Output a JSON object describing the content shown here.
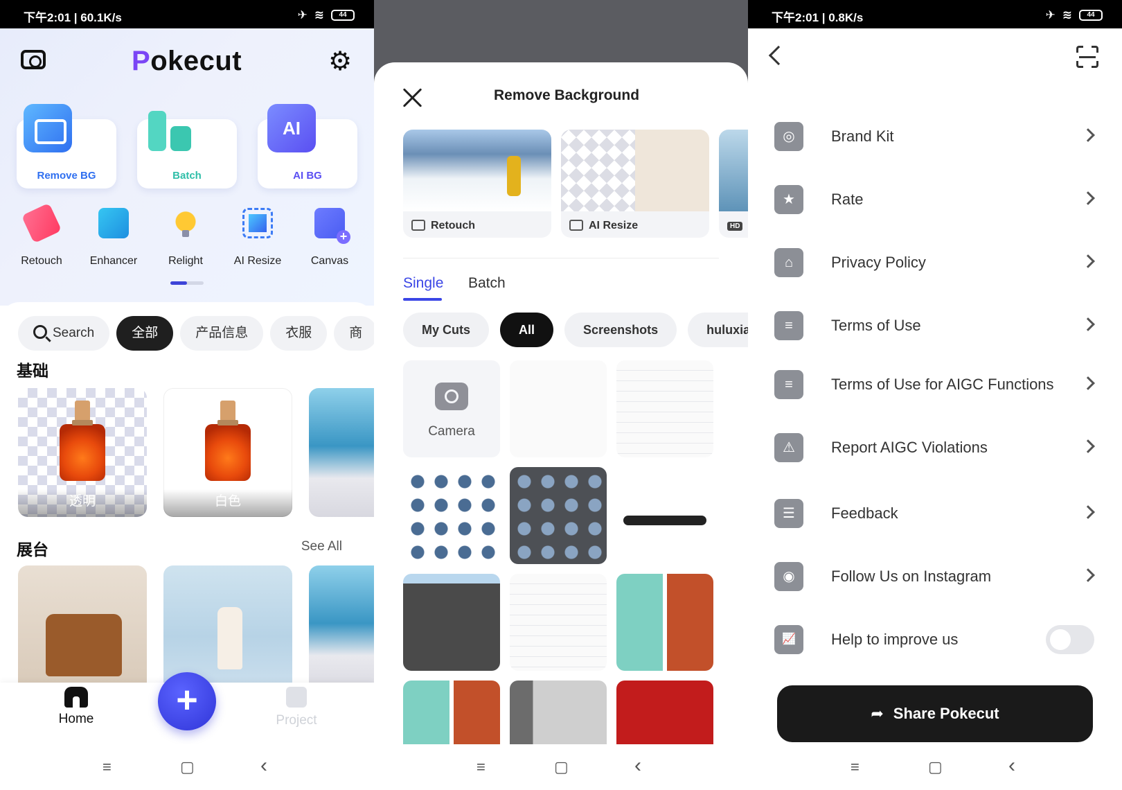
{
  "status_left": {
    "time": "下午2:01",
    "speed": "60.1K/s"
  },
  "status_right": {
    "time": "下午2:01",
    "speed": "0.8K/s"
  },
  "status_icons": {
    "airplane": "✈",
    "wifi": "≋",
    "battery": "44"
  },
  "nav_icons": {
    "menu": "≡",
    "home": "▢",
    "back": "‹"
  },
  "home": {
    "logo_first": "P",
    "logo_rest": "okecut",
    "cards": [
      {
        "label": "Remove BG",
        "color": "#2f6ff0"
      },
      {
        "label": "Batch",
        "color": "#2fbea8"
      },
      {
        "label": "AI BG",
        "color": "#5a4ff2",
        "icon_text": "AI"
      }
    ],
    "tools": [
      {
        "label": "Retouch"
      },
      {
        "label": "Enhancer"
      },
      {
        "label": "Relight"
      },
      {
        "label": "AI Resize"
      },
      {
        "label": "Canvas"
      }
    ],
    "chips": [
      {
        "label": "Search",
        "active": false
      },
      {
        "label": "全部",
        "active": true
      },
      {
        "label": "产品信息",
        "active": false
      },
      {
        "label": "衣服",
        "active": false
      },
      {
        "label": "商",
        "active": false
      }
    ],
    "section_basic": "基础",
    "basic_items": [
      {
        "label": "透明"
      },
      {
        "label": "白色"
      }
    ],
    "section_stage": "展台",
    "see_all": "See All",
    "tab_home": "Home",
    "tab_project": "Project",
    "fab_symbol": "+"
  },
  "remove_bg": {
    "title": "Remove Background",
    "features": [
      {
        "label": "Retouch"
      },
      {
        "label": "AI Resize"
      },
      {
        "label": "HD"
      }
    ],
    "tabs": [
      {
        "label": "Single",
        "active": true
      },
      {
        "label": "Batch",
        "active": false
      }
    ],
    "chips": [
      {
        "label": "My Cuts",
        "active": false
      },
      {
        "label": "All",
        "active": true
      },
      {
        "label": "Screenshots",
        "active": false
      },
      {
        "label": "huluxia",
        "active": false
      }
    ],
    "camera_label": "Camera"
  },
  "settings": {
    "items": [
      {
        "label": "Brand Kit",
        "icon": "◎",
        "control": "chevron"
      },
      {
        "label": "Rate",
        "icon": "★",
        "control": "chevron"
      },
      {
        "label": "Privacy Policy",
        "icon": "⌂",
        "control": "chevron"
      },
      {
        "label": "Terms of Use",
        "icon": "≡",
        "control": "chevron"
      },
      {
        "label": "Terms of Use for AIGC Functions",
        "icon": "≡",
        "control": "chevron"
      },
      {
        "label": "Report AIGC Violations",
        "icon": "⚠",
        "control": "chevron"
      },
      {
        "label": "Feedback",
        "icon": "☰",
        "control": "chevron"
      },
      {
        "label": "Follow Us on Instagram",
        "icon": "◉",
        "control": "chevron"
      },
      {
        "label": "Help to improve us",
        "icon": "📈",
        "control": "toggle",
        "toggle_on": false
      }
    ],
    "share_label": "Share Pokecut",
    "share_icon": "➦"
  }
}
